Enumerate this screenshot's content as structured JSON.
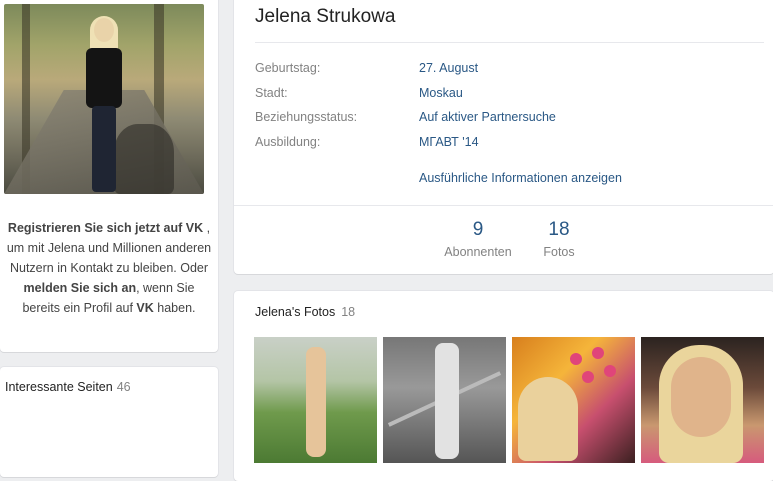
{
  "sidebar": {
    "register": {
      "link_register": "Registrieren Sie sich jetzt auf VK",
      "after_register": " , um mit Jelena und Millionen anderen Nutzern in Kontakt zu bleiben. Oder ",
      "link_login": "melden Sie sich an",
      "after_login": ", wenn Sie bereits ein Profil auf ",
      "brand": "VK",
      "end": " haben."
    },
    "interesting_pages": {
      "label": "Interessante Seiten",
      "count": "46"
    }
  },
  "profile": {
    "name": "Jelena Strukowa",
    "info": [
      {
        "label": "Geburtstag:",
        "value": "27. August"
      },
      {
        "label": "Stadt:",
        "value": "Moskau"
      },
      {
        "label": "Beziehungsstatus:",
        "value": "Auf aktiver Partnersuche"
      },
      {
        "label": "Ausbildung:",
        "value": "МГАВТ '14"
      }
    ],
    "more_info": "Ausführliche Informationen anzeigen",
    "counters": [
      {
        "num": "9",
        "label": "Abonnenten"
      },
      {
        "num": "18",
        "label": "Fotos"
      }
    ]
  },
  "photos": {
    "title": "Jelena's Fotos",
    "count": "18"
  }
}
